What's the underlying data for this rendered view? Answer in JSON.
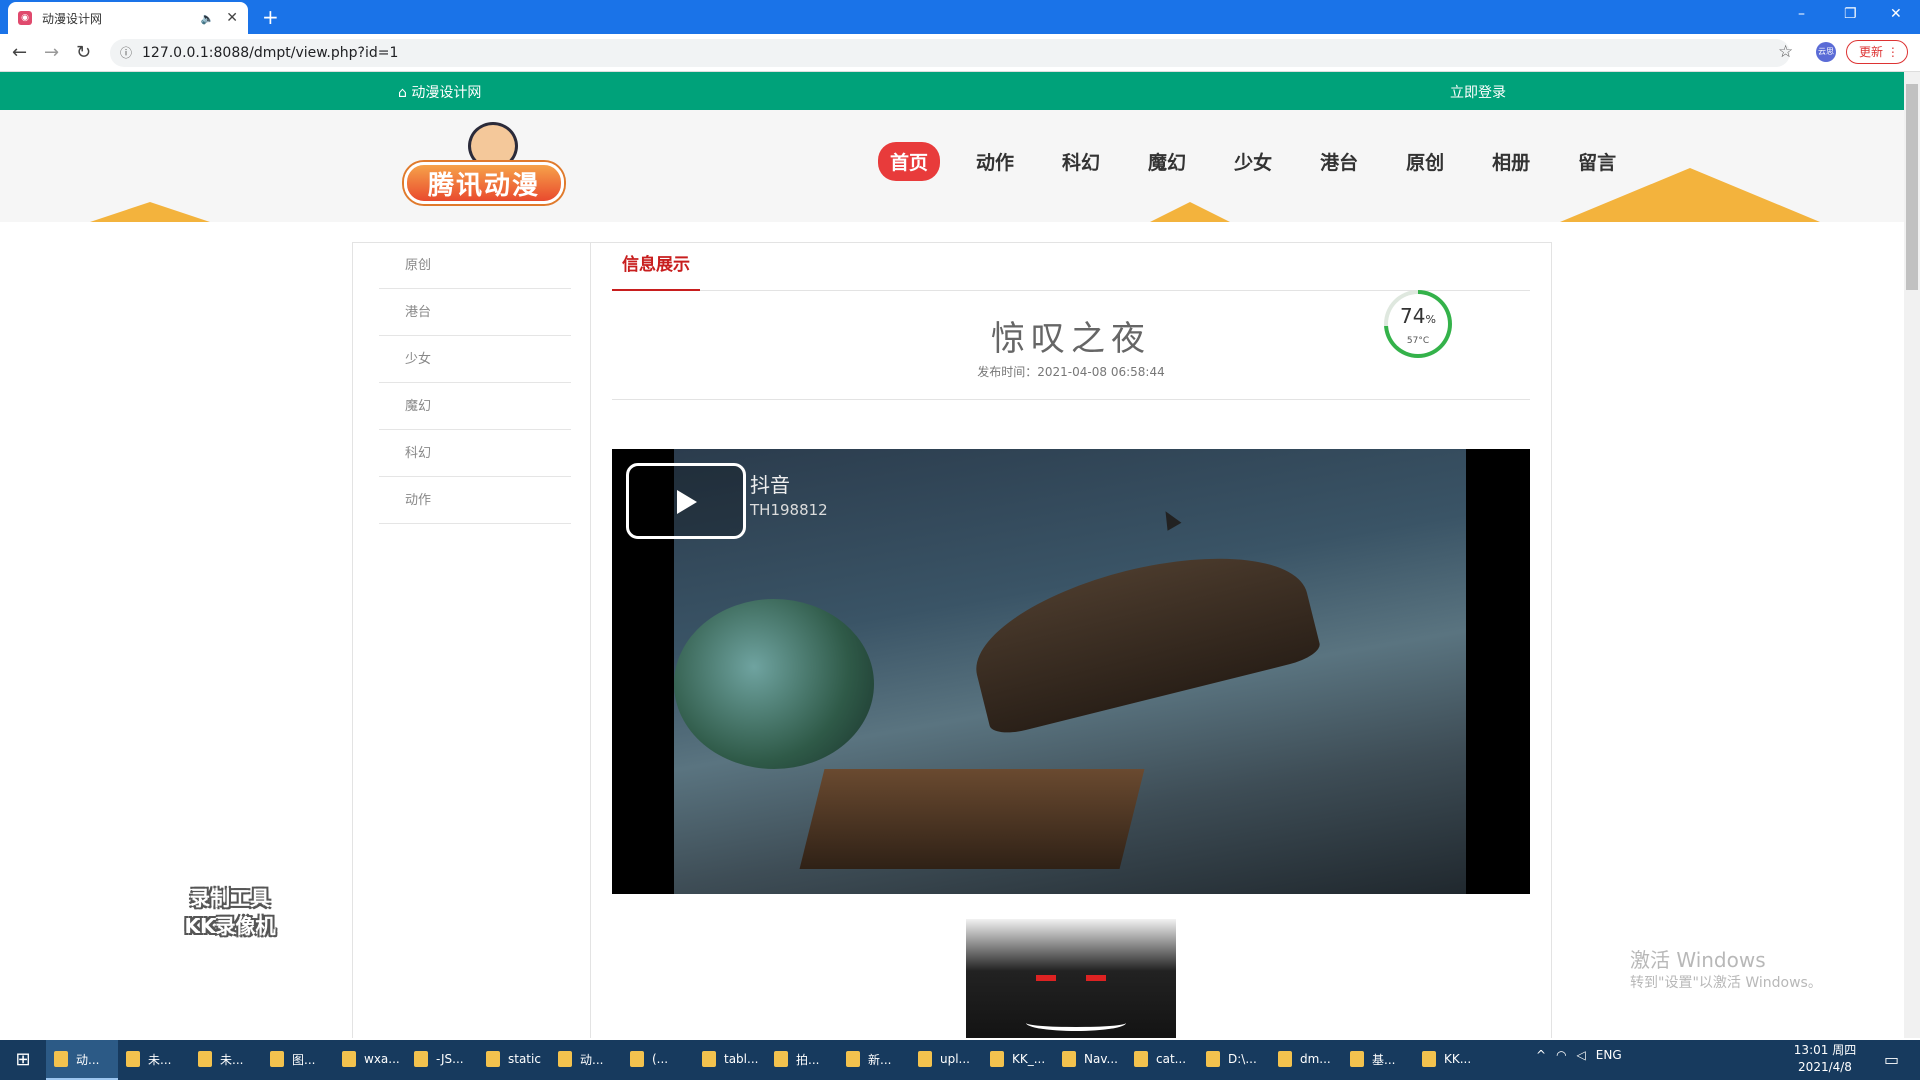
{
  "browser": {
    "tab_title": "动漫设计网",
    "favicon": "site-favicon",
    "url": "127.0.0.1:8088/dmpt/view.php?id=1",
    "profile": "云思",
    "update_button": "更新",
    "new_tab": "+",
    "min": "–",
    "max": "❐",
    "close": "✕"
  },
  "site": {
    "name": "动漫设计网",
    "login": "立即登录",
    "logo_text": "腾讯动漫",
    "nav": [
      "首页",
      "动作",
      "科幻",
      "魔幻",
      "少女",
      "港台",
      "原创",
      "相册",
      "留言"
    ],
    "active_nav": "首页",
    "accent_color": "#00a27a",
    "nav_active_color": "#e83b3b"
  },
  "sidebar": {
    "items": [
      "原创",
      "港台",
      "少女",
      "魔幻",
      "科幻",
      "动作"
    ]
  },
  "article": {
    "section_tab": "信息展示",
    "title": "惊叹之夜",
    "publish": "发布时间：2021-04-08 06:58:44"
  },
  "video": {
    "watermark_1": "抖音",
    "watermark_2": "TH198812"
  },
  "gauge": {
    "percent": "74",
    "unit": "%",
    "temp": "57°C",
    "value_fraction": 0.74
  },
  "overlay": {
    "recorder_line1": "录制工具",
    "recorder_line2": "KK录像机",
    "win_activate": "激活 Windows",
    "win_activate_sub": "转到\"设置\"以激活 Windows。"
  },
  "taskbar": {
    "items": [
      "动...",
      "未...",
      "未...",
      "图...",
      "wxa...",
      "-JS...",
      "static",
      "动...",
      "(...",
      "tabl...",
      "拍...",
      "新...",
      "upl...",
      "KK_...",
      "Nav...",
      "cat...",
      "D:\\...",
      "dm...",
      "基...",
      "KK..."
    ],
    "lang": "ENG",
    "time": "13:01 周四",
    "date": "2021/4/8"
  }
}
